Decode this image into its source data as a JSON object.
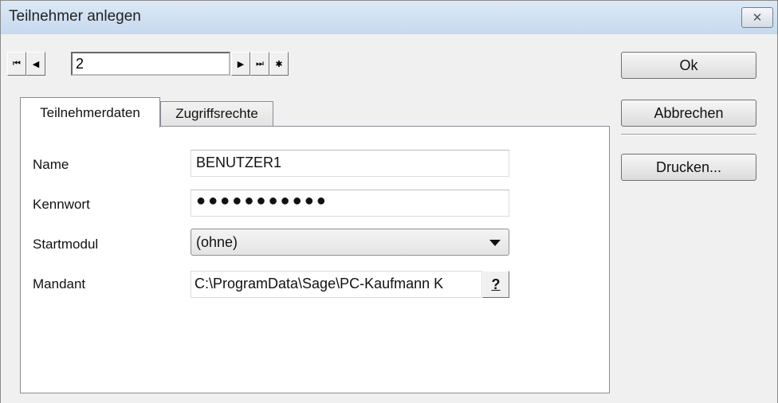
{
  "window": {
    "title": "Teilnehmer anlegen",
    "close_glyph": "✕"
  },
  "navigator": {
    "first_glyph": "⏮",
    "prev_glyph": "◀",
    "record_value": "2",
    "next_glyph": "▶",
    "last_glyph": "⏭",
    "new_glyph": "✱"
  },
  "buttons": {
    "ok": "Ok",
    "cancel": "Abbrechen",
    "print": "Drucken..."
  },
  "tabs": [
    {
      "label": "Teilnehmerdaten"
    },
    {
      "label": "Zugriffsrechte"
    }
  ],
  "form": {
    "name_label": "Name",
    "name_value": "BENUTZER1",
    "password_label": "Kennwort",
    "password_value": "●●●●●●●●●●●",
    "startmodule_label": "Startmodul",
    "startmodule_value": "(ohne)",
    "client_label": "Mandant",
    "client_value": "C:\\ProgramData\\Sage\\PC-Kaufmann K",
    "help_label": "?"
  }
}
